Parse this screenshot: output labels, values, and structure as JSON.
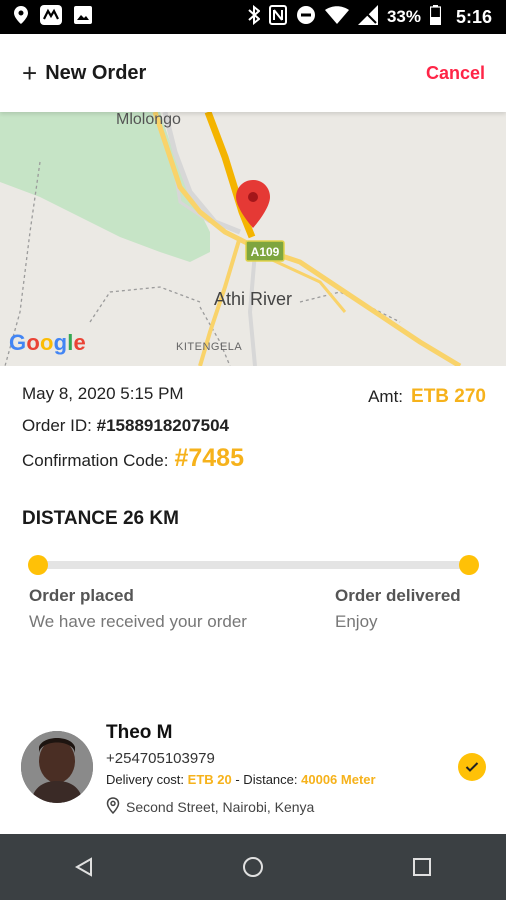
{
  "status_bar": {
    "battery": "33%",
    "time": "5:16",
    "icons_left": [
      "location-icon",
      "app-icon",
      "image-icon"
    ],
    "icons_right": [
      "bluetooth-icon",
      "nfc-icon",
      "dnd-icon",
      "wifi-icon",
      "signal-icon",
      "battery-icon"
    ]
  },
  "header": {
    "title": "New Order",
    "cancel_label": "Cancel"
  },
  "map": {
    "labels": {
      "town_top": "Mlolongo",
      "city": "Athi River",
      "kitengela": "KITENGELA",
      "road": "A109"
    },
    "logo": [
      "G",
      "o",
      "o",
      "g",
      "l",
      "e"
    ]
  },
  "order": {
    "datetime": "May 8, 2020 5:15 PM",
    "amount_label": "Amt:",
    "amount_value": "ETB 270",
    "order_id_label": "Order ID:",
    "order_id_value": "#1588918207504",
    "confirmation_label": "Confirmation Code:",
    "confirmation_value": "#7485",
    "distance": "DISTANCE 26 KM"
  },
  "progress": {
    "steps": [
      {
        "title": "Order placed",
        "subtitle": "We have received your order"
      },
      {
        "title": "Order delivered",
        "subtitle": "Enjoy"
      }
    ]
  },
  "courier": {
    "name": "Theo M",
    "phone": "+254705103979",
    "delivery_cost_label": "Delivery cost:",
    "delivery_cost_value": "ETB 20",
    "distance_label": "- Distance:",
    "distance_value": "40006 Meter",
    "address": "Second Street, Nairobi, Kenya"
  },
  "colors": {
    "accent": "#f6b21b",
    "cancel": "#ff2547",
    "progress_dot": "#ffc107"
  }
}
